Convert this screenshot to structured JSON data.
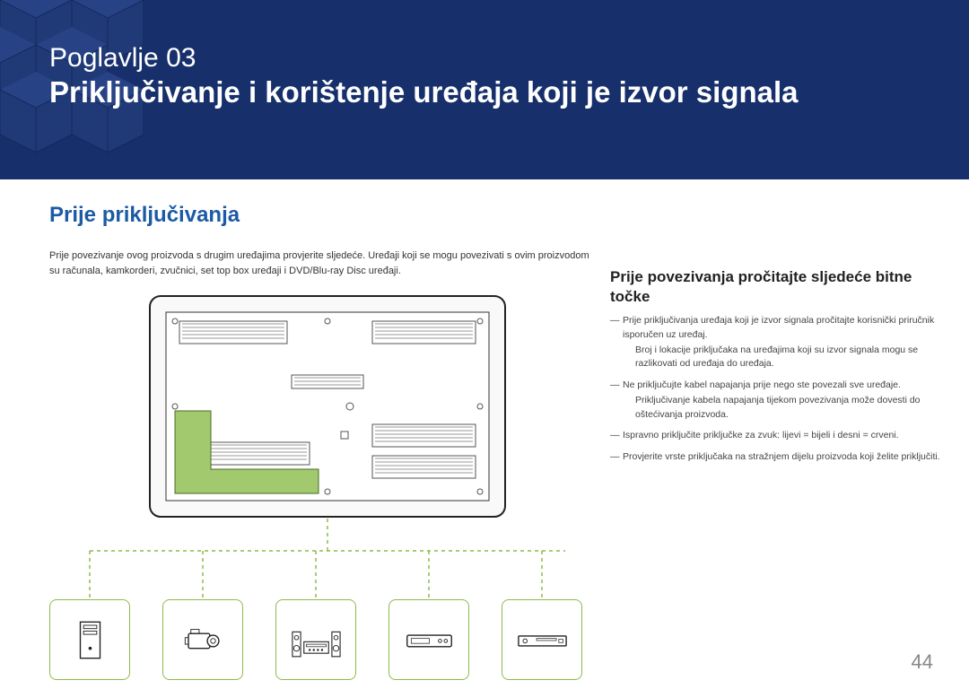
{
  "header": {
    "chapter_label": "Poglavlje  03",
    "chapter_title": "Priključivanje i korištenje uređaja koji je izvor signala"
  },
  "section_title": "Prije priključivanja",
  "intro_text": "Prije povezivanje ovog proizvoda s drugim uređajima provjerite sljedeće. Uređaji koji se mogu povezivati s ovim proizvodom su računala, kamkorderi, zvučnici, set top box uređaji i DVD/Blu-ray Disc uređaji.",
  "right": {
    "heading": "Prije povezivanja pročitajte sljedeće bitne točke",
    "items": [
      {
        "main": "Prije priključivanja uređaja koji je izvor signala pročitajte korisnički priručnik isporučen uz uređaj.",
        "sub": "Broj i lokacije priključaka na uređajima koji su izvor signala mogu se razlikovati od uređaja do uređaja."
      },
      {
        "main": "Ne priključujte kabel napajanja prije nego ste povezali sve uređaje.",
        "sub": "Priključivanje kabela napajanja tijekom povezivanja može dovesti do oštećivanja proizvoda."
      },
      {
        "main": "Ispravno priključite priključke za zvuk: lijevi = bijeli i desni = crveni."
      },
      {
        "main": "Provjerite vrste priključaka na stražnjem dijelu proizvoda koji želite priključiti."
      }
    ]
  },
  "page_number": "44"
}
